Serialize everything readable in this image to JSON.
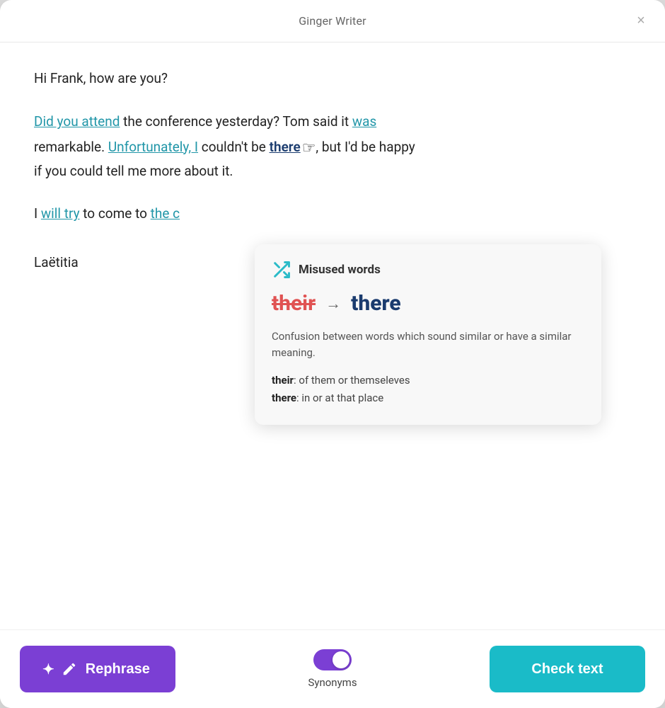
{
  "window": {
    "title": "Ginger Writer"
  },
  "close_button": "×",
  "content": {
    "greeting": "Hi Frank, how are you?",
    "paragraph1_parts": [
      {
        "type": "link",
        "text": "Did you attend"
      },
      {
        "type": "text",
        "text": " the conference yesterday? Tom said it "
      },
      {
        "type": "link",
        "text": "was"
      },
      {
        "type": "text",
        "text": "\nremarkable. "
      },
      {
        "type": "link",
        "text": "Unfortunately, I"
      },
      {
        "type": "text",
        "text": " couldn't be "
      },
      {
        "type": "highlight",
        "text": "there"
      },
      {
        "type": "text",
        "text": ", but I'd be happy\nif you could tell me more about it."
      }
    ],
    "paragraph2_visible": "I will try to come to the c",
    "paragraph2_link1": "will try",
    "paragraph2_link2": "the c",
    "signature": "Laëtitia"
  },
  "tooltip": {
    "icon_label": "misused-words-icon",
    "title": "Misused words",
    "wrong_word": "their",
    "arrow": "→",
    "correct_word": "there",
    "description": "Confusion between words which sound similar or have a similar meaning.",
    "def1_word": "their",
    "def1_text": "of them or themseleves",
    "def2_word": "there",
    "def2_text": "in or at that place"
  },
  "bottom_bar": {
    "rephrase_label": "Rephrase",
    "synonyms_label": "Synonyms",
    "check_text_label": "Check text",
    "toggle_on": true
  }
}
